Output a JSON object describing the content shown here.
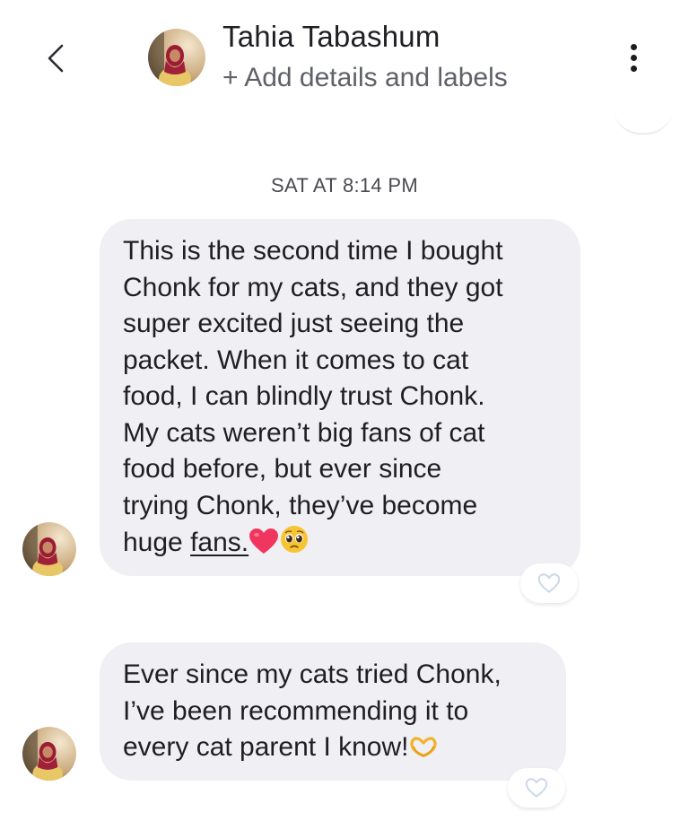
{
  "header": {
    "back_icon": "chevron-left-icon",
    "contact_name": "Tahia Tabashum",
    "subtitle": "+ Add details and labels",
    "more_icon": "more-vertical-icon"
  },
  "conversation": {
    "timestamp": "SAT AT 8:14 PM",
    "messages": [
      {
        "lines": [
          "This is the second time I bought",
          "Chonk for my cats, and they got",
          "super excited just seeing the",
          "packet. When it comes to cat",
          "food, I can blindly trust Chonk.",
          "My cats weren’t big fans of cat",
          "food before, but ever since",
          "trying Chonk, they’ve become"
        ],
        "last_line_prefix": "huge ",
        "last_line_underlined": "fans.",
        "emojis": [
          "heart-emoji",
          "pleading-face-emoji"
        ],
        "reaction_icon": "heart-outline-icon"
      },
      {
        "lines": [
          "Ever since my cats tried Chonk,",
          "I’ve been recommending it to"
        ],
        "last_line": "every cat parent I know!",
        "emojis": [
          "heart-hands-emoji"
        ],
        "reaction_icon": "heart-outline-icon"
      }
    ]
  },
  "colors": {
    "bubble_bg": "#f0f0f4",
    "text": "#1f1f23",
    "subtle_text": "#5f6168",
    "heart_pink": "#f0365f",
    "reaction_outline": "#c9d7ea"
  }
}
